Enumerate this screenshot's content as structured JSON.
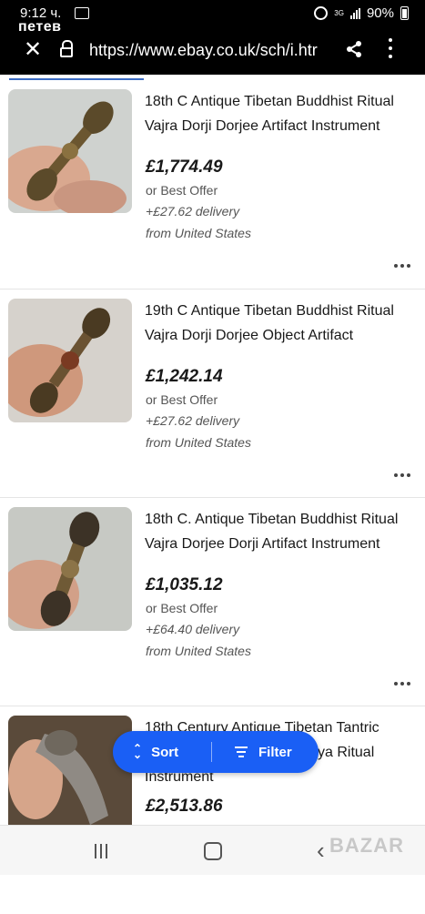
{
  "status_bar": {
    "time": "9:12 ч.",
    "carrier": "петев",
    "network": "3G",
    "battery": "90%"
  },
  "browser": {
    "url": "https://www.ebay.co.uk/sch/i.htr"
  },
  "listings": [
    {
      "title_line1": "18th C Antique Tibetan Buddhist Ritual",
      "title_line2": "Vajra Dorji Dorjee Artifact Instrument",
      "price": "£1,774.49",
      "offer": "or Best Offer",
      "delivery": "+£27.62 delivery",
      "location": "from United States"
    },
    {
      "title_line1": "19th C Antique Tibetan Buddhist Ritual",
      "title_line2": "Vajra Dorji Dorjee Object Artifact",
      "price": "£1,242.14",
      "offer": "or Best Offer",
      "delivery": "+£27.62 delivery",
      "location": "from United States"
    },
    {
      "title_line1": "18th C. Antique Tibetan Buddhist Ritual",
      "title_line2": "Vajra Dorjee Dorji Artifact Instrument",
      "price": "£1,035.12",
      "offer": "or Best Offer",
      "delivery": "+£64.40 delivery",
      "location": "from United States"
    },
    {
      "title_line1": "18th Century Antique Tibetan Tantric",
      "title_line2": "ya Ritual",
      "title_line3": "Instrument",
      "price": "£2,513.86"
    }
  ],
  "floating_bar": {
    "sort_label": "Sort",
    "filter_label": "Filter"
  },
  "watermark": "BAZAR"
}
